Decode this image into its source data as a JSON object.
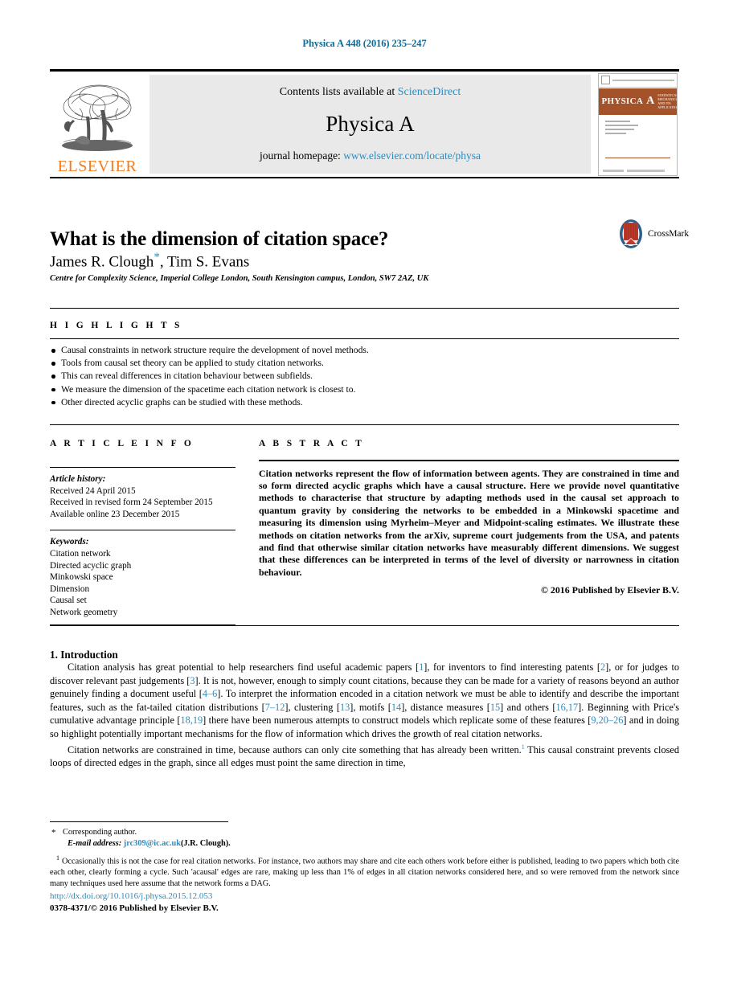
{
  "running_head": "Physica A 448 (2016) 235–247",
  "masthead": {
    "contents_prefix": "Contents lists available at ",
    "sciencedirect": "ScienceDirect",
    "journal_name": "Physica A",
    "homepage_prefix": "journal homepage: ",
    "homepage_url": "www.elsevier.com/locate/physa",
    "publisher_wordmark": "ELSEVIER",
    "cover": {
      "title": "PHYSICA",
      "volume_letter": "A",
      "subtitle": "STATISTICAL MECHANICS AND ITS APPLICATIONS"
    }
  },
  "article": {
    "title": "What is the dimension of citation space?",
    "authors": "James R. Clough",
    "authors_rest": ", Tim S. Evans",
    "corresponding_mark": "*",
    "affiliation": "Centre for Complexity Science, Imperial College London, South Kensington campus, London, SW7 2AZ, UK",
    "crossmark_label": "CrossMark"
  },
  "highlights": {
    "heading": "H I G H L I G H T S",
    "items": [
      "Causal constraints in network structure require the development of novel methods.",
      "Tools from causal set theory can be applied to study citation networks.",
      "This can reveal differences in citation behaviour between subfields.",
      "We measure the dimension of the spacetime each citation network is closest to.",
      "Other directed acyclic graphs can be studied with these methods."
    ]
  },
  "article_info": {
    "heading": "A R T I C L E   I N F O",
    "history_label": "Article history:",
    "history": [
      "Received 24 April 2015",
      "Received in revised form 24 September 2015",
      "Available online 23 December 2015"
    ],
    "keywords_label": "Keywords:",
    "keywords": [
      "Citation network",
      "Directed acyclic graph",
      "Minkowski space",
      "Dimension",
      "Causal set",
      "Network geometry"
    ]
  },
  "abstract": {
    "heading": "A B S T R A C T",
    "text": "Citation networks represent the flow of information between agents. They are constrained in time and so form directed acyclic graphs which have a causal structure. Here we provide novel quantitative methods to characterise that structure by adapting methods used in the causal set approach to quantum gravity by considering the networks to be embedded in a Minkowski spacetime and measuring its dimension using Myrheim–Meyer and Midpoint-scaling estimates. We illustrate these methods on citation networks from the arXiv, supreme court judgements from the USA, and patents and find that otherwise similar citation networks have measurably different dimensions. We suggest that these differences can be interpreted in terms of the level of diversity or narrowness in citation behaviour.",
    "copyright": "© 2016 Published by Elsevier B.V."
  },
  "introduction": {
    "section_title": "1. Introduction",
    "paragraph1_parts": [
      "Citation analysis has great potential to help researchers find useful academic papers [",
      "1",
      "], for inventors to find interesting patents [",
      "2",
      "], or for judges to discover relevant past judgements [",
      "3",
      "]. It is not, however, enough to simply count citations, because they can be made for a variety of reasons beyond an author genuinely finding a document useful [",
      "4–6",
      "]. To interpret the information encoded in a citation network we must be able to identify and describe the important features, such as the fat-tailed citation distributions [",
      "7–12",
      "], clustering [",
      "13",
      "], motifs  [",
      "14",
      "], distance measures [",
      "15",
      "] and others [",
      "16,17",
      "]. Beginning with Price's cumulative advantage principle [",
      "18,19",
      "] there have been numerous attempts to construct models which replicate some of these features [",
      "9,20–26",
      "] and in doing so highlight potentially important mechanisms for the flow of information which drives the growth of real citation networks."
    ],
    "paragraph2_a": "Citation networks are constrained in time, because authors can only cite something that has already been written.",
    "paragraph2_marker": "1",
    "paragraph2_b": " This causal constraint prevents closed loops of directed edges in the graph, since all edges must point the same direction in time,"
  },
  "footnotes": {
    "corresponding_mark": "*",
    "corresponding_text": "Corresponding author.",
    "email_label": "E-mail address:",
    "email": "jrc309@ic.ac.uk",
    "email_owner": "(J.R. Clough).",
    "note_marker": "1",
    "note_text": "Occasionally this is not the case for real citation networks. For instance, two authors may share and cite each others work before either is published, leading to two papers which both cite each other, clearly forming a cycle. Such 'acausal' edges are rare, making up less than 1% of edges in all citation networks considered here, and so were removed from the network since many techniques used here assume that the network forms a DAG."
  },
  "footer": {
    "doi": "http://dx.doi.org/10.1016/j.physa.2015.12.053",
    "issn": "0378-4371/© 2016 Published by Elsevier B.V."
  },
  "colors": {
    "link": "#2b8cbe",
    "running_head": "#0b6d9c",
    "elsevier_orange": "#F47C20",
    "cover_band": "#A4522A"
  }
}
